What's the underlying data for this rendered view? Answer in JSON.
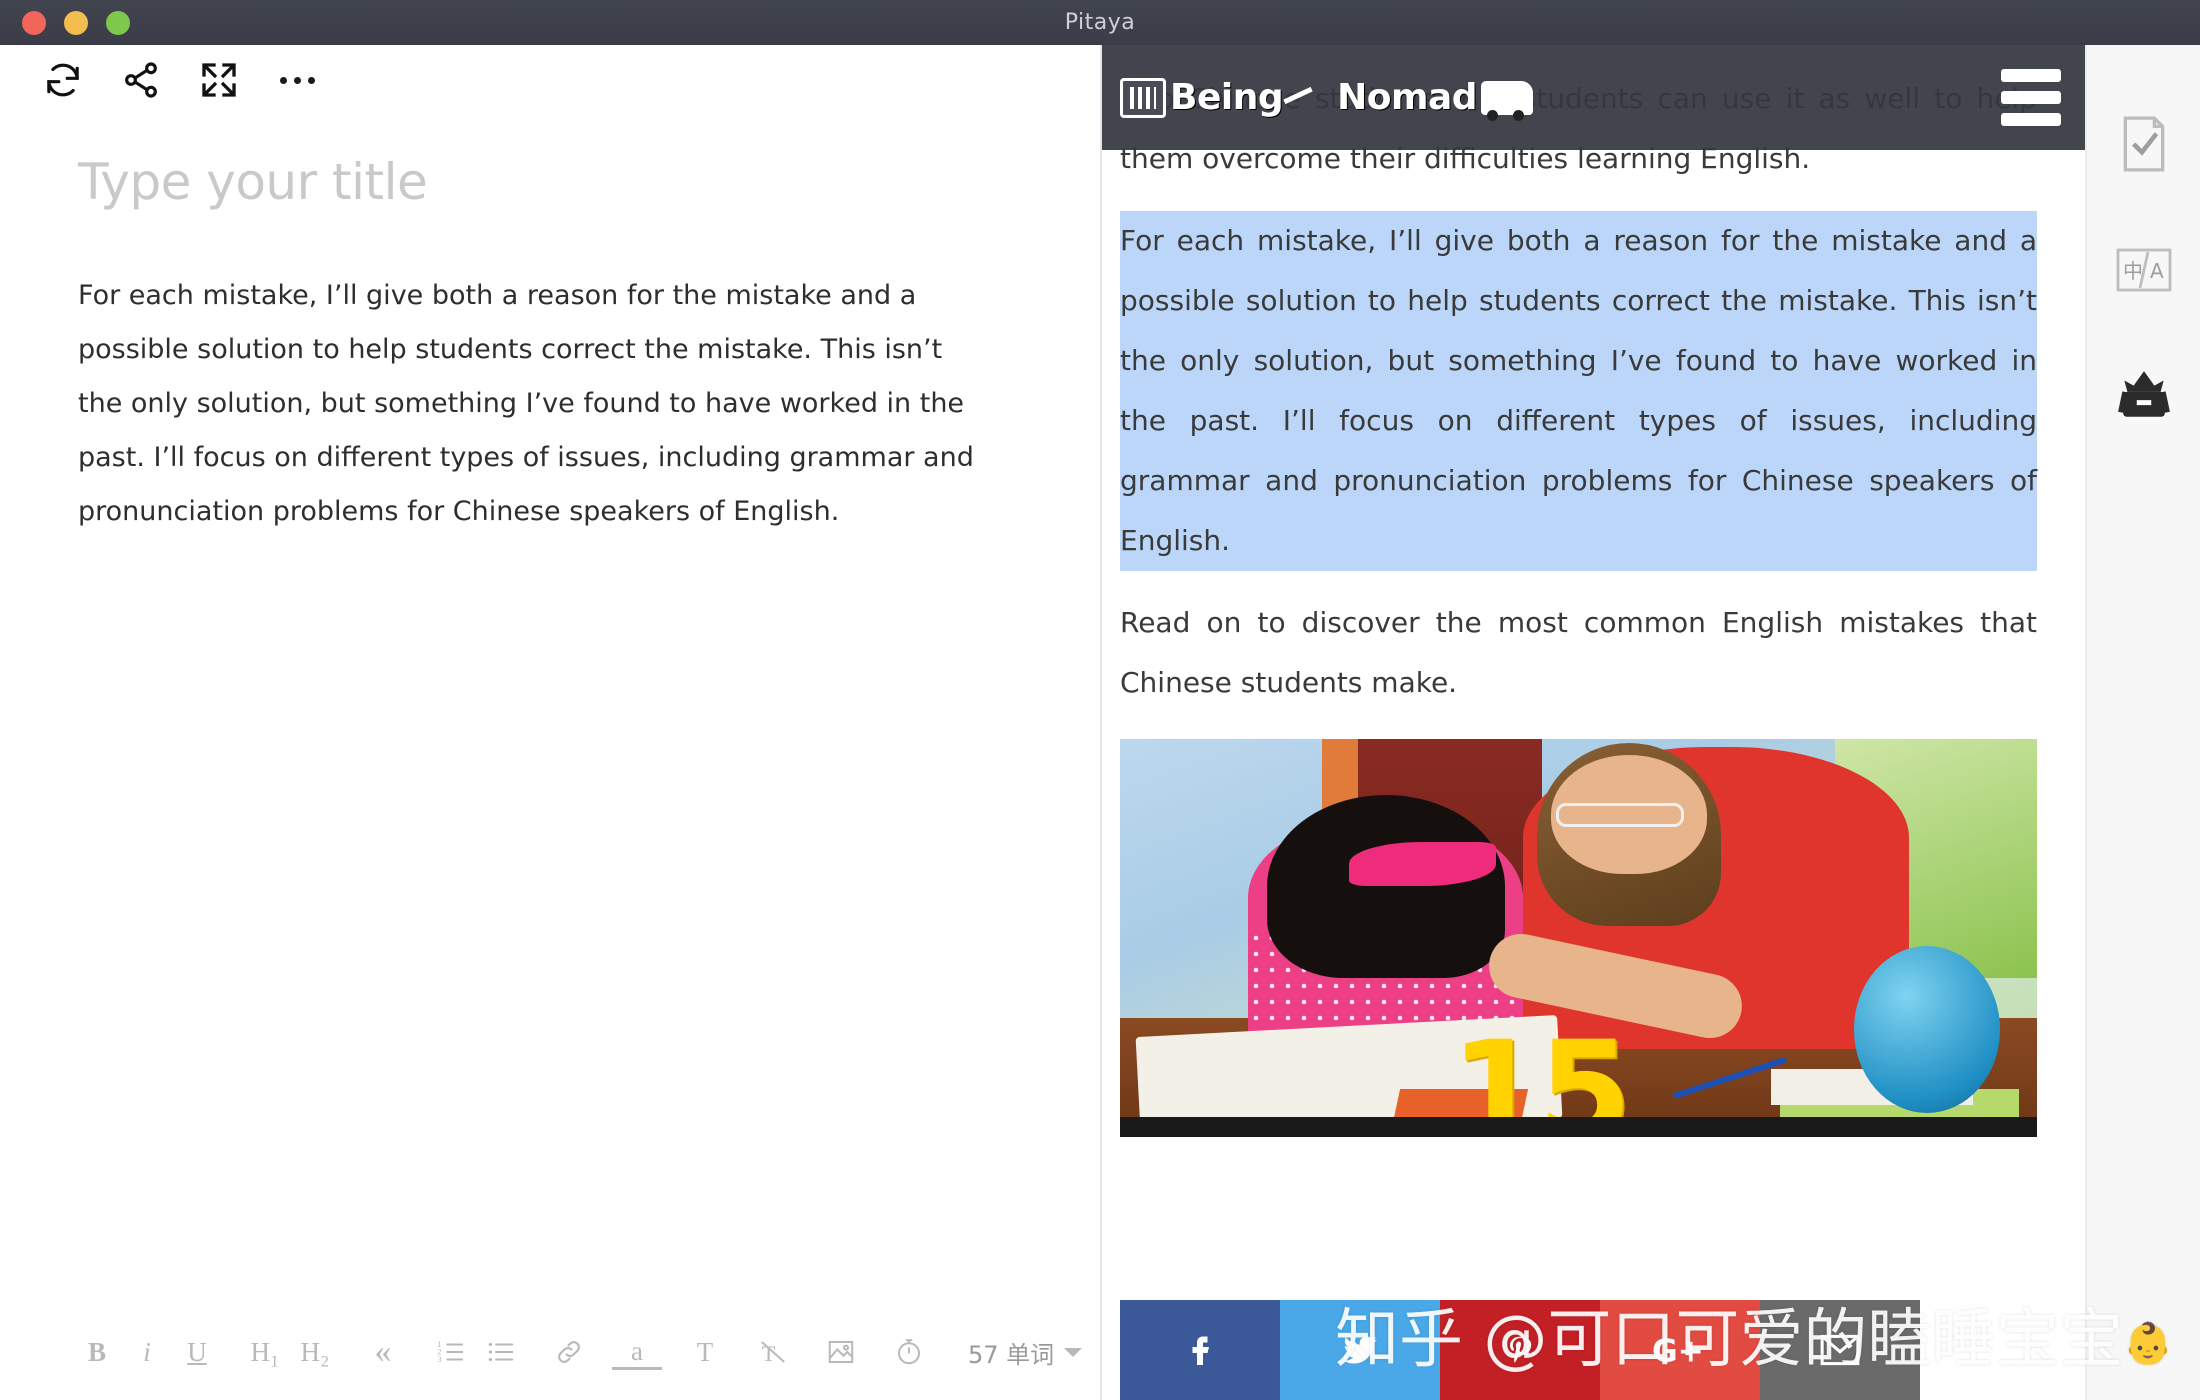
{
  "window": {
    "title": "Pitaya",
    "traffic_lights": [
      "close",
      "minimize",
      "zoom"
    ]
  },
  "editor_toolbar": {
    "buttons": [
      {
        "name": "sync-icon",
        "label": "Sync"
      },
      {
        "name": "share-icon",
        "label": "Share"
      },
      {
        "name": "fullscreen-icon",
        "label": "Fullscreen"
      },
      {
        "name": "more-icon",
        "label": "More"
      }
    ]
  },
  "editor": {
    "title_placeholder": "Type your title",
    "body": "For each mistake, I’ll give both a reason for the mistake and a possible solution to help students correct the mistake. This isn’t the only solution, but something I’ve found to have worked in the past. I’ll focus on different types of issues, including grammar and pronunciation problems for Chinese speakers of English."
  },
  "format_bar": {
    "items": [
      {
        "name": "bold-button",
        "label": "B"
      },
      {
        "name": "italic-button",
        "label": "i"
      },
      {
        "name": "underline-button",
        "label": "U"
      },
      {
        "name": "heading1-button",
        "label": "H₁"
      },
      {
        "name": "heading2-button",
        "label": "H₂"
      },
      {
        "name": "blockquote-button",
        "label": "«"
      },
      {
        "name": "ordered-list-button",
        "label": ""
      },
      {
        "name": "bullet-list-button",
        "label": ""
      },
      {
        "name": "link-button",
        "label": ""
      },
      {
        "name": "highlight-button",
        "label": "a"
      },
      {
        "name": "text-style-button",
        "label": "T"
      },
      {
        "name": "clear-format-button",
        "label": ""
      },
      {
        "name": "insert-image-button",
        "label": ""
      },
      {
        "name": "timer-button",
        "label": ""
      }
    ],
    "word_count": "57 单词"
  },
  "preview": {
    "site_logo_text": "Being",
    "site_logo_text2": "Nomad",
    "menu_label": "Menu",
    "paragraphs": [
      {
        "id": "para-intro",
        "text": "...to Chinese students. But students can use it as well to help them overcome their difficulties learning English.",
        "selected": false
      },
      {
        "id": "para-selected",
        "text": "For each mistake, I’ll give both a reason for the mistake and a possible solution to help students correct the mistake. This isn’t the only solution, but something I’ve found to have worked in the past. I’ll focus on different types of issues, including grammar and pronunciation problems for Chinese speakers of English.",
        "selected": true
      },
      {
        "id": "para-readon",
        "text": "Read on to discover the most common English mistakes that Chinese students make.",
        "selected": false
      }
    ],
    "image_overlay_number": "15",
    "image_alt": "Teacher helping a young student with homework at a desk with a globe"
  },
  "social_bar": {
    "buttons": [
      {
        "name": "facebook-share-button",
        "label": "f",
        "color": "#3b5998"
      },
      {
        "name": "twitter-share-button",
        "label": "",
        "color": "#4aa8e8"
      },
      {
        "name": "pinterest-share-button",
        "label": "p",
        "color": "#c32026"
      },
      {
        "name": "googleplus-share-button",
        "label": "G+",
        "color": "#e14b41"
      },
      {
        "name": "email-share-button",
        "label": "",
        "color": "#6a6a6a"
      }
    ]
  },
  "icon_rail": {
    "items": [
      {
        "name": "proofread-icon",
        "label": "Proofread"
      },
      {
        "name": "translate-icon",
        "label": "中/A"
      },
      {
        "name": "archive-icon",
        "label": "Archive"
      }
    ]
  },
  "watermark": {
    "text": "知乎 @可口可爱的瞌睡宝宝",
    "emoji": "👶"
  },
  "colors": {
    "titlebar": "#3a3d48",
    "selection": "#bbd6f8",
    "site_header": "#343740",
    "rail_bg": "#f7f7f7"
  }
}
